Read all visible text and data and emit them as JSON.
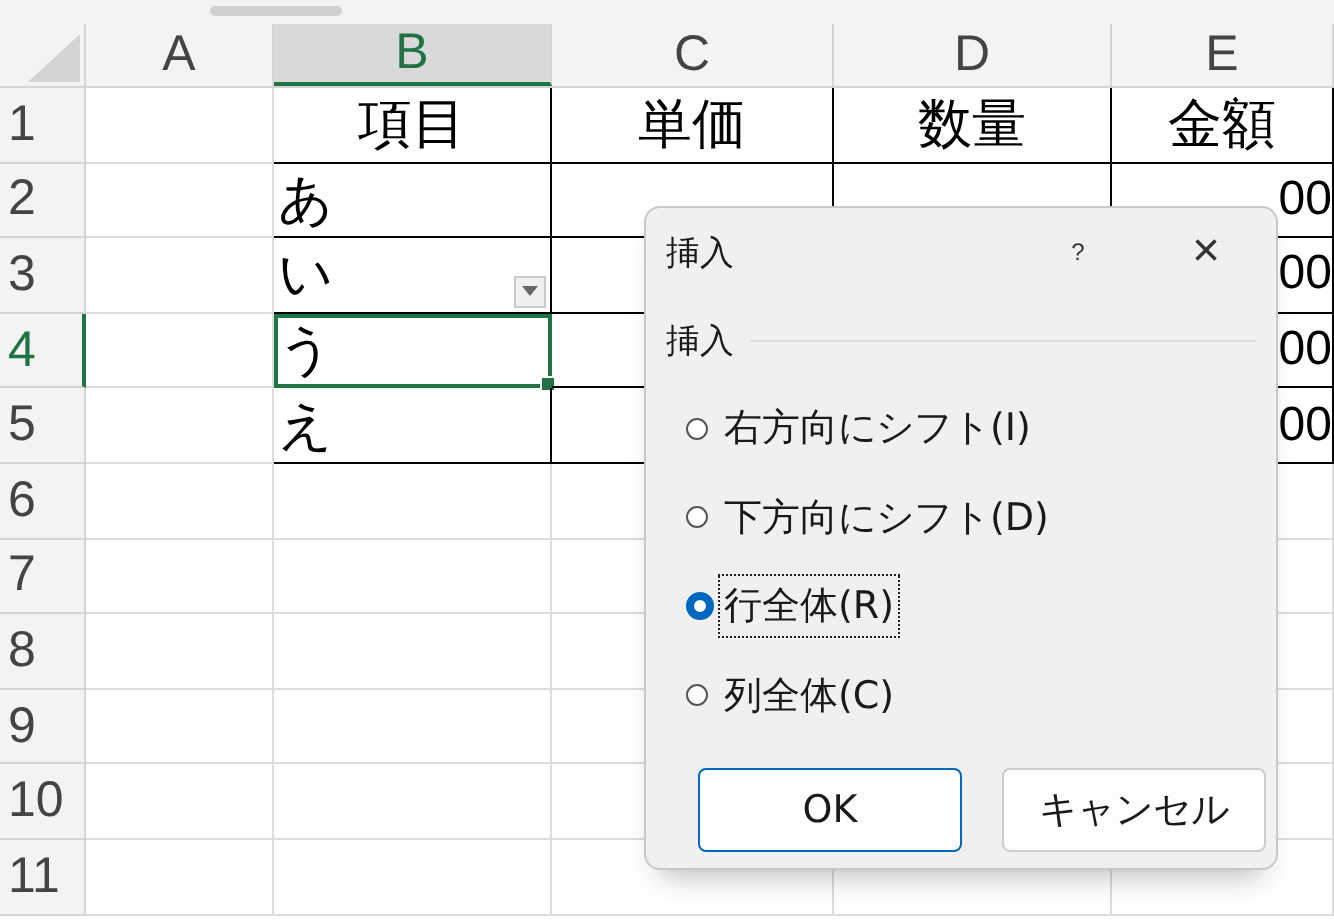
{
  "columns": [
    {
      "label": "A",
      "selected": false
    },
    {
      "label": "B",
      "selected": true
    },
    {
      "label": "C",
      "selected": false
    },
    {
      "label": "D",
      "selected": false
    },
    {
      "label": "E",
      "selected": false
    }
  ],
  "rows": [
    {
      "label": "1",
      "selected": false,
      "b": "項目",
      "c": "単価",
      "d": "数量",
      "e": "金額"
    },
    {
      "label": "2",
      "selected": false,
      "b": "あ",
      "e": "00"
    },
    {
      "label": "3",
      "selected": false,
      "b": "い",
      "b_dropdown": true,
      "e": "00"
    },
    {
      "label": "4",
      "selected": true,
      "b": "う",
      "e": "00"
    },
    {
      "label": "5",
      "selected": false,
      "b": "え",
      "e": "00"
    },
    {
      "label": "6",
      "selected": false
    },
    {
      "label": "7",
      "selected": false
    },
    {
      "label": "8",
      "selected": false
    },
    {
      "label": "9",
      "selected": false
    },
    {
      "label": "10",
      "selected": false
    },
    {
      "label": "11",
      "selected": false
    }
  ],
  "dialog": {
    "title": "挿入",
    "help": "?",
    "close": "×",
    "group_label": "挿入",
    "options": [
      {
        "label": "右方向にシフト(I)",
        "selected": false
      },
      {
        "label": "下方向にシフト(D)",
        "selected": false
      },
      {
        "label": "行全体(R)",
        "selected": true
      },
      {
        "label": "列全体(C)",
        "selected": false
      }
    ],
    "buttons": [
      {
        "label": "OK",
        "default": true
      },
      {
        "label": "キャンセル",
        "default": false
      }
    ]
  }
}
